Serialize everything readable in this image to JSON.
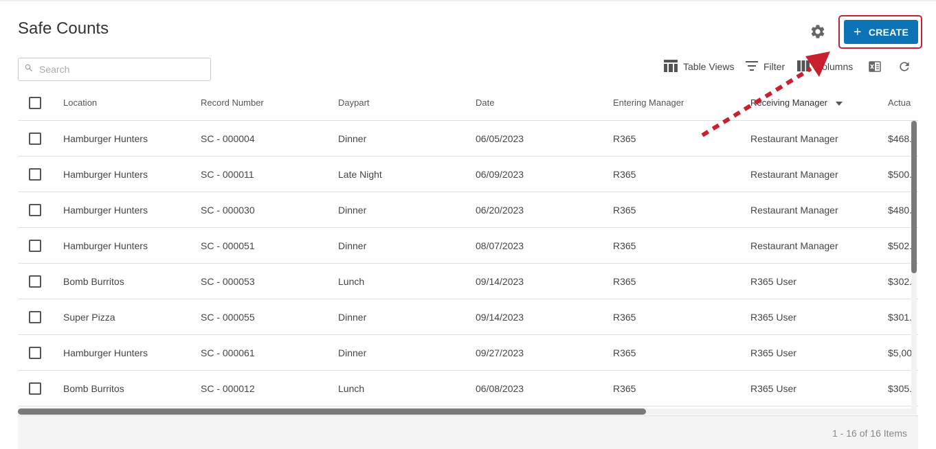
{
  "page": {
    "title": "Safe Counts"
  },
  "header": {
    "create_label": "CREATE"
  },
  "search": {
    "placeholder": "Search"
  },
  "toolbar": {
    "table_views_label": "Table Views",
    "filter_label": "Filter",
    "columns_label": "Columns"
  },
  "table": {
    "columns": [
      "Location",
      "Record Number",
      "Daypart",
      "Date",
      "Entering Manager",
      "Receiving Manager",
      "Actua"
    ],
    "rows": [
      [
        "Hamburger Hunters",
        "SC - 000004",
        "Dinner",
        "06/05/2023",
        "R365",
        "Restaurant Manager",
        "$468."
      ],
      [
        "Hamburger Hunters",
        "SC - 000011",
        "Late Night",
        "06/09/2023",
        "R365",
        "Restaurant Manager",
        "$500."
      ],
      [
        "Hamburger Hunters",
        "SC - 000030",
        "Dinner",
        "06/20/2023",
        "R365",
        "Restaurant Manager",
        "$480."
      ],
      [
        "Hamburger Hunters",
        "SC - 000051",
        "Dinner",
        "08/07/2023",
        "R365",
        "Restaurant Manager",
        "$502."
      ],
      [
        "Bomb Burritos",
        "SC - 000053",
        "Lunch",
        "09/14/2023",
        "R365",
        "R365 User",
        "$302."
      ],
      [
        "Super Pizza",
        "SC - 000055",
        "Dinner",
        "09/14/2023",
        "R365",
        "R365 User",
        "$301."
      ],
      [
        "Hamburger Hunters",
        "SC - 000061",
        "Dinner",
        "09/27/2023",
        "R365",
        "R365 User",
        "$5,00"
      ],
      [
        "Bomb Burritos",
        "SC - 000012",
        "Lunch",
        "06/08/2023",
        "R365",
        "R365 User",
        "$305."
      ]
    ]
  },
  "pagination": {
    "summary": "1 - 16 of 16 Items"
  },
  "colors": {
    "primary": "#0b73b6",
    "annotation_red": "#c8202f"
  }
}
